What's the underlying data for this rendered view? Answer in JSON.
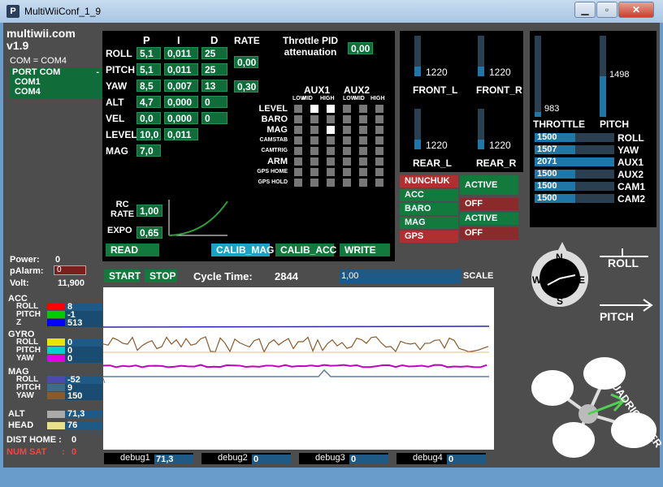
{
  "window": {
    "title": "MultiWiiConf_1_9",
    "icon_glyph": "P"
  },
  "brand": {
    "name": "multiwii.com",
    "version": "v1.9"
  },
  "com": {
    "label": "COM = COM4",
    "dropdown_label": "PORT COM",
    "dropdown_arrow": "-",
    "ports": [
      "COM1",
      "COM4"
    ]
  },
  "pid": {
    "headers": {
      "p": "P",
      "i": "I",
      "d": "D",
      "rate": "RATE"
    },
    "rows": [
      {
        "name": "ROLL",
        "p": "5,1",
        "i": "0,011",
        "d": "25"
      },
      {
        "name": "PITCH",
        "p": "5,1",
        "i": "0,011",
        "d": "25"
      },
      {
        "name": "YAW",
        "p": "8,5",
        "i": "0,007",
        "d": "13"
      },
      {
        "name": "ALT",
        "p": "4,7",
        "i": "0,000",
        "d": "0"
      },
      {
        "name": "VEL",
        "p": "0,0",
        "i": "0,000",
        "d": "0"
      },
      {
        "name": "LEVEL",
        "p": "10,0",
        "i": "0,011",
        "d": ""
      },
      {
        "name": "MAG",
        "p": "7,0",
        "i": "",
        "d": ""
      }
    ],
    "rate_roll_pitch": "0,00",
    "rate_yaw": "0,30",
    "throttle_pid_label": "Throttle PID\nattenuation",
    "throttle_pid_value": "0,00",
    "rc_rate_label": "RC\nRATE",
    "rc_rate_value": "1,00",
    "expo_label": "EXPO",
    "expo_value": "0,65"
  },
  "aux": {
    "aux1_label": "AUX1",
    "aux2_label": "AUX2",
    "sub_labels": [
      "LOW",
      "MID",
      "HIGH",
      "LOW",
      "MID",
      "HIGH"
    ],
    "rows": [
      {
        "name": "LEVEL",
        "states": [
          0,
          1,
          1,
          0,
          0,
          0
        ]
      },
      {
        "name": "BARO",
        "states": [
          0,
          0,
          0,
          0,
          0,
          0
        ]
      },
      {
        "name": "MAG",
        "states": [
          0,
          0,
          1,
          0,
          0,
          0
        ]
      },
      {
        "name": "CAMSTAB",
        "states": [
          0,
          0,
          0,
          0,
          0,
          0
        ]
      },
      {
        "name": "CAMTRIG",
        "states": [
          0,
          0,
          0,
          0,
          0,
          0
        ]
      },
      {
        "name": "ARM",
        "states": [
          0,
          0,
          0,
          0,
          0,
          0
        ]
      },
      {
        "name": "GPS HOME",
        "states": [
          0,
          0,
          0,
          0,
          0,
          0
        ]
      },
      {
        "name": "GPS HOLD",
        "states": [
          0,
          0,
          0,
          0,
          0,
          0
        ]
      }
    ]
  },
  "buttons": {
    "read": "READ",
    "calib_mag": "CALIB_MAG",
    "calib_acc": "CALIB_ACC",
    "write": "WRITE",
    "start": "START",
    "stop": "STOP"
  },
  "motors": [
    {
      "name": "FRONT_L",
      "value": "1220"
    },
    {
      "name": "FRONT_R",
      "value": "1220"
    },
    {
      "name": "REAR_L",
      "value": "1220"
    },
    {
      "name": "REAR_R",
      "value": "1220"
    }
  ],
  "sensors": [
    {
      "name": "NUNCHUK",
      "color": "#b03030"
    },
    {
      "name": "ACC",
      "color": "#137a3e"
    },
    {
      "name": "BARO",
      "color": "#137a3e"
    },
    {
      "name": "MAG",
      "color": "#137a3e"
    },
    {
      "name": "GPS",
      "color": "#b03030"
    }
  ],
  "sensor_states": [
    {
      "label": "ACTIVE",
      "color": "#137a3e"
    },
    {
      "label": "OFF",
      "color": "#8a2a2a"
    },
    {
      "label": "ACTIVE",
      "color": "#137a3e"
    },
    {
      "label": "OFF",
      "color": "#8a2a2a"
    }
  ],
  "rc": {
    "throttle": {
      "label": "THROTTLE",
      "value": "983"
    },
    "pitch": {
      "label": "PITCH",
      "value": "1498"
    },
    "channels": [
      {
        "name": "ROLL",
        "value": "1500"
      },
      {
        "name": "YAW",
        "value": "1507"
      },
      {
        "name": "AUX1",
        "value": "2071"
      },
      {
        "name": "AUX2",
        "value": "1500"
      },
      {
        "name": "CAM1",
        "value": "1500"
      },
      {
        "name": "CAM2",
        "value": "1500"
      }
    ]
  },
  "status": {
    "power_label": "Power:",
    "power_value": "0",
    "palarm_label": "pAlarm:",
    "palarm_value": "0",
    "volt_label": "Volt:",
    "volt_value": "11,900",
    "cycle_label": "Cycle Time:",
    "cycle_value": "2844",
    "scale_value": "1,00",
    "scale_label": "SCALE"
  },
  "sensor_readouts": {
    "acc_label": "ACC",
    "acc": [
      {
        "name": "ROLL",
        "value": "8",
        "color": "#ff0000"
      },
      {
        "name": "PITCH",
        "value": "-1",
        "color": "#00cc00"
      },
      {
        "name": "Z",
        "value": "513",
        "color": "#0000ff"
      }
    ],
    "gyro_label": "GYRO",
    "gyro": [
      {
        "name": "ROLL",
        "value": "0",
        "color": "#e6e600"
      },
      {
        "name": "PITCH",
        "value": "0",
        "color": "#00d0d0"
      },
      {
        "name": "YAW",
        "value": "0",
        "color": "#e000e0"
      }
    ],
    "mag_label": "MAG",
    "mag": [
      {
        "name": "ROLL",
        "value": "-52",
        "color": "#4a4ab0"
      },
      {
        "name": "PITCH",
        "value": "9",
        "color": "#3c6e8a"
      },
      {
        "name": "YAW",
        "value": "150",
        "color": "#8a5a2a"
      }
    ],
    "alt_label": "ALT",
    "alt_value": "71,3",
    "head_label": "HEAD",
    "head_value": "76",
    "dist_home_label": "DIST HOME :",
    "dist_home_value": "0",
    "num_sat_label": "NUM SAT",
    "num_sat_sep": ":",
    "num_sat_value": "0"
  },
  "debug": [
    {
      "label": "debug1",
      "value": "71,3"
    },
    {
      "label": "debug2",
      "value": "0"
    },
    {
      "label": "debug3",
      "value": "0"
    },
    {
      "label": "debug4",
      "value": "0"
    }
  ],
  "compass": {
    "n": "N",
    "s": "S",
    "e": "E",
    "w": "W"
  },
  "attitude": {
    "roll": "ROLL",
    "pitch": "PITCH"
  },
  "vehicle": {
    "type": "QUADRICOPTER"
  },
  "colors": {
    "panel": "#000000",
    "accent_green": "#106d3a",
    "bar_blue": "#1f77a7"
  }
}
